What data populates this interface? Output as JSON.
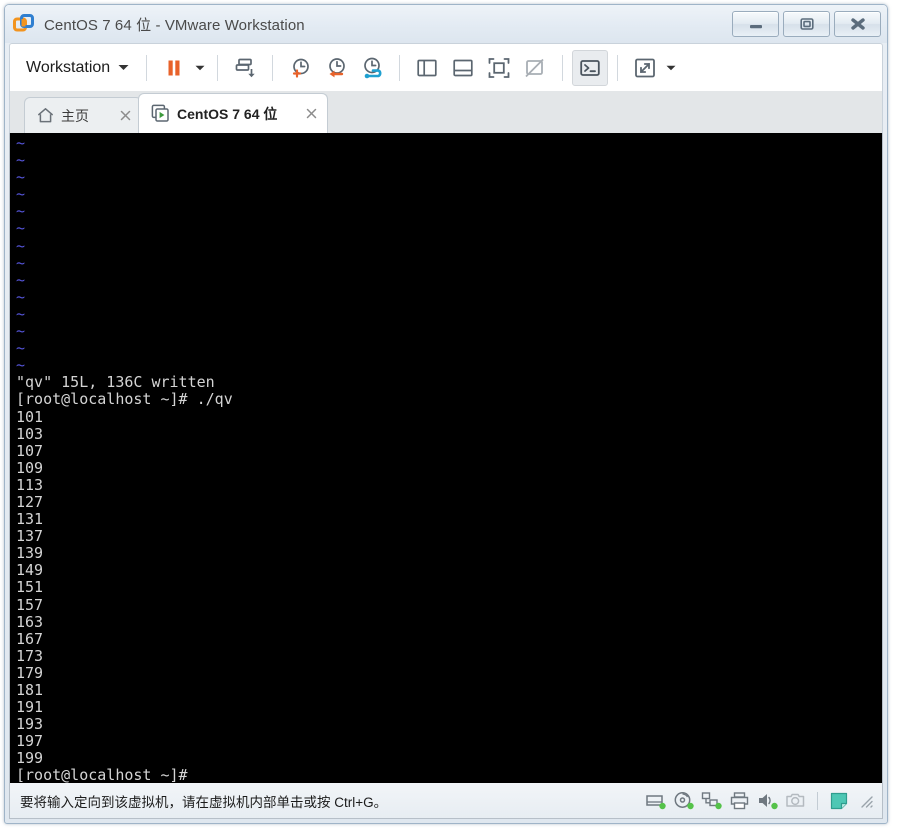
{
  "window": {
    "title": "CentOS 7 64 位 - VMware Workstation",
    "app_icon": "vmware-logo-icon",
    "controls": {
      "minimize": "minimize-icon",
      "maximize": "maximize-icon",
      "close": "close-icon"
    }
  },
  "toolbar": {
    "menu_label": "Workstation",
    "menu_caret": "chevron-down-icon",
    "items": [
      {
        "name": "suspend-button",
        "icon": "pause-icon"
      },
      {
        "name": "suspend-dropdown",
        "icon": "chevron-down-icon"
      },
      {
        "name": "power-button",
        "icon": "power-down-icon"
      },
      {
        "name": "take-snapshot-button",
        "icon": "snapshot-add-icon"
      },
      {
        "name": "revert-snapshot-button",
        "icon": "snapshot-revert-icon"
      },
      {
        "name": "snapshot-manager-button",
        "icon": "snapshot-manager-icon"
      },
      {
        "name": "show-library-button",
        "icon": "panel-left-icon"
      },
      {
        "name": "show-thumbnail-bar-button",
        "icon": "panel-bottom-icon"
      },
      {
        "name": "full-screen-button",
        "icon": "fullscreen-icon"
      },
      {
        "name": "unity-mode-button",
        "icon": "unity-disabled-icon"
      },
      {
        "name": "console-view-button",
        "icon": "console-prompt-icon"
      },
      {
        "name": "stretch-button",
        "icon": "stretch-arrows-icon"
      },
      {
        "name": "stretch-dropdown",
        "icon": "chevron-down-icon"
      }
    ]
  },
  "tabs": [
    {
      "label": "主页",
      "icon": "home-icon",
      "close": "close-icon",
      "active": false
    },
    {
      "label": "CentOS 7 64 位",
      "icon": "vm-play-icon",
      "close": "close-icon",
      "active": true
    }
  ],
  "terminal": {
    "vim_filler_rows": 14,
    "filler_char": "~",
    "lines": [
      "\"qv\" 15L, 136C written",
      "[root@localhost ~]# ./qv",
      "101",
      "103",
      "107",
      "109",
      "113",
      "127",
      "131",
      "137",
      "139",
      "149",
      "151",
      "157",
      "163",
      "167",
      "173",
      "179",
      "181",
      "191",
      "193",
      "197",
      "199",
      "[root@localhost ~]#"
    ]
  },
  "statusbar": {
    "message": "要将输入定向到该虚拟机，请在虚拟机内部单击或按 Ctrl+G。",
    "devices": [
      {
        "name": "hard-disk-icon",
        "connected": true
      },
      {
        "name": "cd-dvd-icon",
        "connected": true
      },
      {
        "name": "network-adapter-icon",
        "connected": true
      },
      {
        "name": "printer-icon",
        "connected": false
      },
      {
        "name": "sound-card-icon",
        "connected": true
      },
      {
        "name": "camera-icon",
        "connected": false
      },
      {
        "name": "message-log-icon",
        "connected": false
      },
      {
        "name": "resize-grip-icon",
        "connected": false
      }
    ]
  },
  "colors": {
    "accent_orange": "#e8622a",
    "accent_blue": "#1fa0d0",
    "device_green": "#55c24a",
    "terminal_bg": "#000000",
    "terminal_fg": "#d4d4d4",
    "vim_tilde": "#5555d8"
  }
}
